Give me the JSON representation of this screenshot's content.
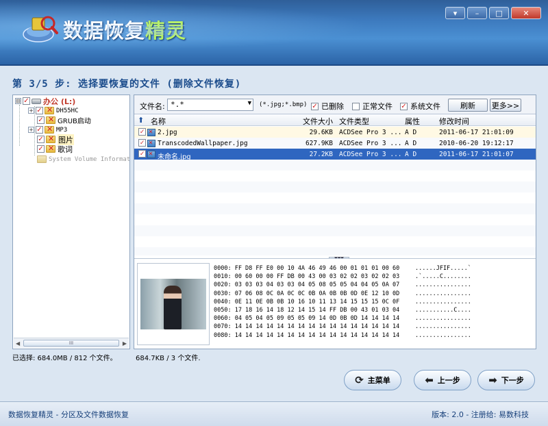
{
  "app": {
    "title_main": "数据恢复",
    "title_accent": "精灵",
    "window_buttons": [
      "▾",
      "–",
      "□",
      "✕"
    ]
  },
  "step": {
    "text": "第 3/5 步: 选择要恢复的文件 (删除文件恢复)"
  },
  "tree": {
    "items": [
      {
        "label": "办公 (L:)",
        "icon": "drive-icon",
        "checked": true,
        "expander": "⊟"
      },
      {
        "label": "DH55HC",
        "icon": "deleted-folder-icon",
        "checked": true,
        "expander": "+"
      },
      {
        "label": "GRUB启动",
        "icon": "deleted-folder-icon",
        "checked": true,
        "expander": ""
      },
      {
        "label": "MP3",
        "icon": "deleted-folder-icon",
        "checked": true,
        "expander": "+"
      },
      {
        "label": "图片",
        "icon": "deleted-folder-icon",
        "checked": true,
        "expander": ""
      },
      {
        "label": "歌词",
        "icon": "deleted-folder-icon",
        "checked": true,
        "expander": ""
      },
      {
        "label": "System Volume Informat",
        "icon": "folder-icon",
        "checked": false,
        "expander": ""
      }
    ],
    "scroll_thumb": "III"
  },
  "toolbar": {
    "filename_label": "文件名:",
    "filename_value": "*.*",
    "filter_hint": "(*.jpg;*.bmp)",
    "deleted_label": "已删除",
    "normal_label": "正常文件",
    "system_label": "系统文件",
    "refresh_label": "刷新",
    "more_label": "更多>>"
  },
  "table": {
    "headers": [
      "名称",
      "文件大小",
      "文件类型",
      "属性",
      "修改时间"
    ],
    "rows": [
      {
        "name": "2.jpg",
        "size": "29.6KB",
        "type": "ACDSee Pro 3 ...",
        "attr": "A D",
        "modified": "2011-06-17 21:01:09"
      },
      {
        "name": "TranscodedWallpaper.jpg",
        "size": "627.9KB",
        "type": "ACDSee Pro 3 ...",
        "attr": "A D",
        "modified": "2010-06-20 19:12:17"
      },
      {
        "name": "未命名.jpg",
        "size": "27.2KB",
        "type": "ACDSee Pro 3 ...",
        "attr": "A D",
        "modified": "2011-06-17 21:01:07"
      }
    ]
  },
  "hex": {
    "lines": [
      "0000: FF D8 FF E0 00 10 4A 46 49 46 00 01 01 01 00 60",
      "0010: 00 60 00 00 FF DB 00 43 00 03 02 02 03 02 02 03",
      "0020: 03 03 03 04 03 03 04 05 08 05 05 04 04 05 0A 07",
      "0030: 07 06 08 0C 0A 0C 0C 0B 0A 0B 0B 0D 0E 12 10 0D",
      "0040: 0E 11 0E 0B 0B 10 16 10 11 13 14 15 15 15 0C 0F",
      "0050: 17 18 16 14 18 12 14 15 14 FF DB 00 43 01 03 04",
      "0060: 04 05 04 05 09 05 05 09 14 0D 0B 0D 14 14 14 14",
      "0070: 14 14 14 14 14 14 14 14 14 14 14 14 14 14 14 14",
      "0080: 14 14 14 14 14 14 14 14 14 14 14 14 14 14 14 14"
    ],
    "ascii": [
      "......JFIF.....`",
      ".`.....C........",
      "................",
      "................",
      "................",
      "...........C....",
      "................",
      "................",
      "................"
    ]
  },
  "status": {
    "left": "已选择: 684.0MB / 812 个文件。",
    "right": "684.7KB / 3 个文件."
  },
  "nav": {
    "main_menu": "主菜单",
    "prev": "上一步",
    "next": "下一步"
  },
  "footer": {
    "left": "数据恢复精灵 - 分区及文件数据恢复",
    "right": "版本: 2.0 - 注册给: 易数科技"
  }
}
